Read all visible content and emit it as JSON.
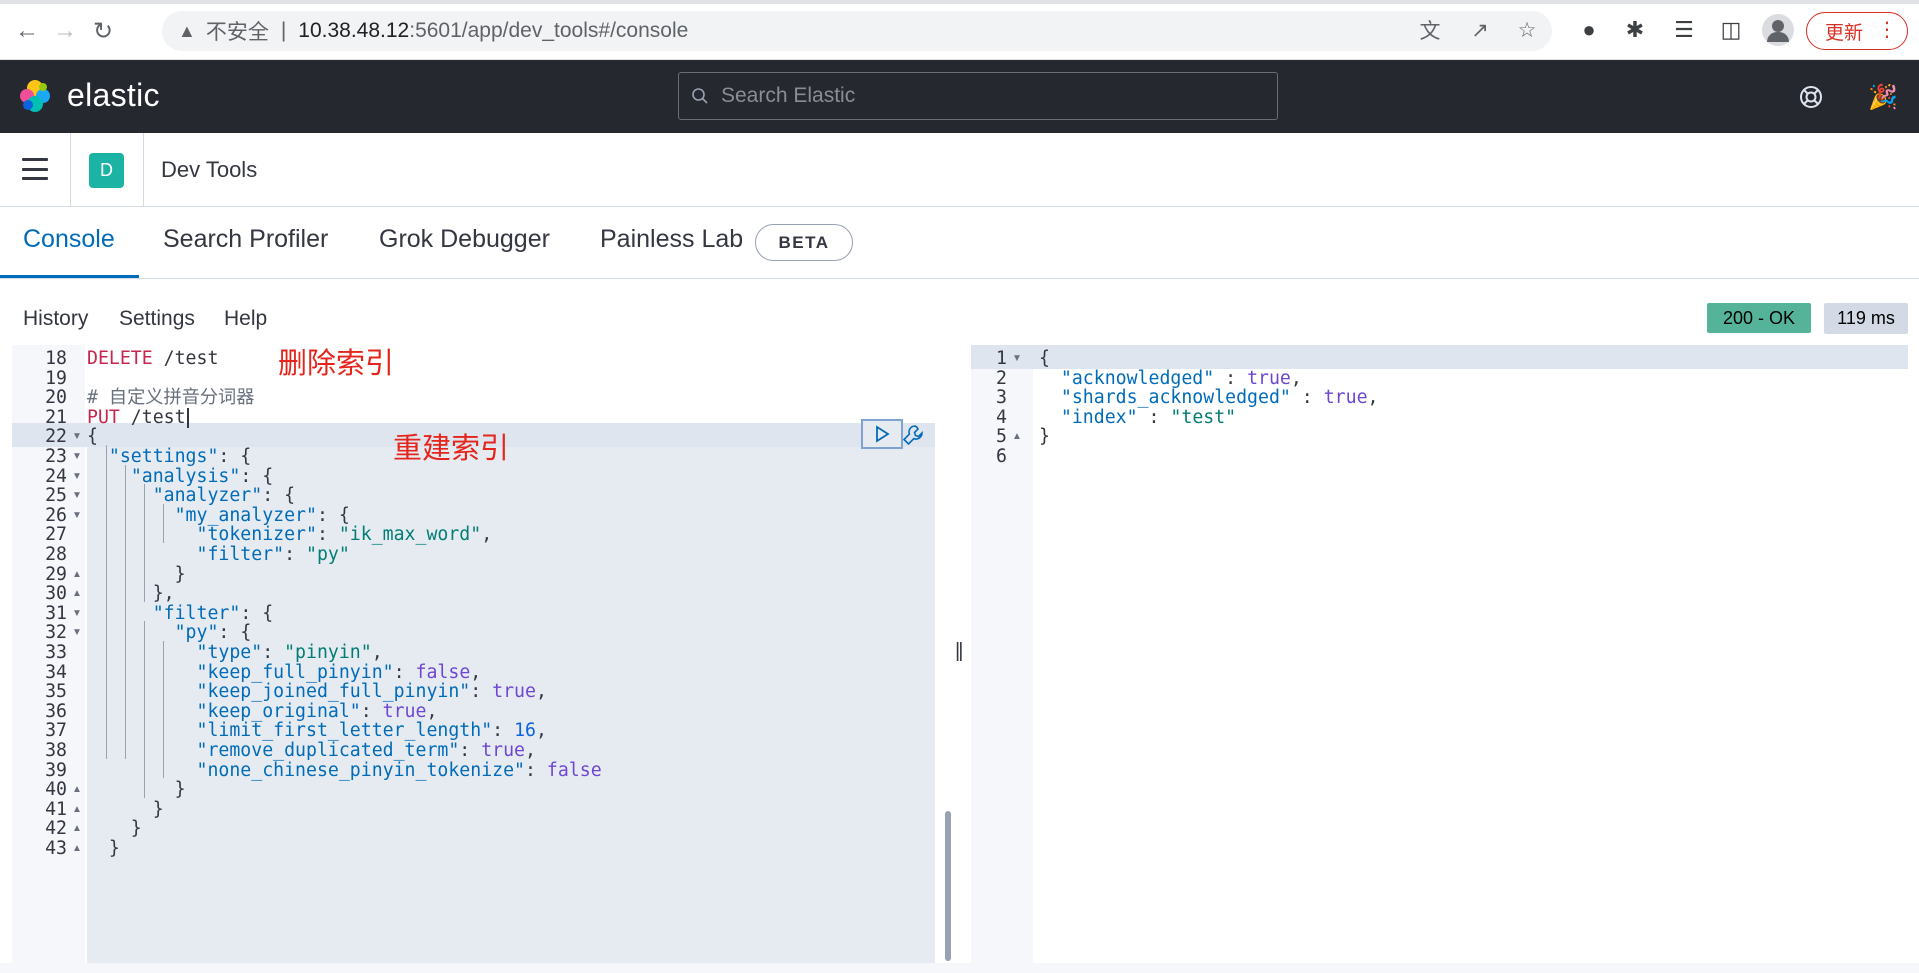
{
  "browser": {
    "security_label": "不安全",
    "url_host": "10.38.48.12",
    "url_path": ":5601/app/dev_tools#/console",
    "update_label": "更新"
  },
  "header": {
    "logo_text": "elastic",
    "search_placeholder": "Search Elastic"
  },
  "breadcrumb": {
    "space_initial": "D",
    "title": "Dev Tools"
  },
  "tabs": [
    {
      "label": "Console",
      "active": true
    },
    {
      "label": "Search Profiler",
      "active": false
    },
    {
      "label": "Grok Debugger",
      "active": false
    },
    {
      "label": "Painless Lab",
      "active": false
    }
  ],
  "beta_badge": "BETA",
  "console_menu": [
    "History",
    "Settings",
    "Help"
  ],
  "status": {
    "code": "200 - OK",
    "time": "119 ms"
  },
  "annotations": {
    "delete_index": "删除索引",
    "rebuild_index": "重建索引"
  },
  "request_lines": [
    {
      "n": "18",
      "text": "DELETE /test"
    },
    {
      "n": "19",
      "text": ""
    },
    {
      "n": "20",
      "text": "# 自定义拼音分词器"
    },
    {
      "n": "21",
      "text": "PUT /test"
    },
    {
      "n": "22",
      "text": "{"
    },
    {
      "n": "23",
      "text": "  \"settings\": {"
    },
    {
      "n": "24",
      "text": "    \"analysis\": {"
    },
    {
      "n": "25",
      "text": "      \"analyzer\": {"
    },
    {
      "n": "26",
      "text": "        \"my_analyzer\": {"
    },
    {
      "n": "27",
      "text": "          \"tokenizer\": \"ik_max_word\","
    },
    {
      "n": "28",
      "text": "          \"filter\": \"py\""
    },
    {
      "n": "29",
      "text": "        }"
    },
    {
      "n": "30",
      "text": "      },"
    },
    {
      "n": "31",
      "text": "      \"filter\": {"
    },
    {
      "n": "32",
      "text": "        \"py\": {"
    },
    {
      "n": "33",
      "text": "          \"type\": \"pinyin\","
    },
    {
      "n": "34",
      "text": "          \"keep_full_pinyin\": false,"
    },
    {
      "n": "35",
      "text": "          \"keep_joined_full_pinyin\": true,"
    },
    {
      "n": "36",
      "text": "          \"keep_original\": true,"
    },
    {
      "n": "37",
      "text": "          \"limit_first_letter_length\": 16,"
    },
    {
      "n": "38",
      "text": "          \"remove_duplicated_term\": true,"
    },
    {
      "n": "39",
      "text": "          \"none_chinese_pinyin_tokenize\": false"
    },
    {
      "n": "40",
      "text": "        }"
    },
    {
      "n": "41",
      "text": "      }"
    },
    {
      "n": "42",
      "text": "    }"
    },
    {
      "n": "43",
      "text": "  }"
    }
  ],
  "response_lines": [
    {
      "n": "1",
      "text": "{"
    },
    {
      "n": "2",
      "text": "  \"acknowledged\" : true,"
    },
    {
      "n": "3",
      "text": "  \"shards_acknowledged\" : true,"
    },
    {
      "n": "4",
      "text": "  \"index\" : \"test\""
    },
    {
      "n": "5",
      "text": "}"
    },
    {
      "n": "6",
      "text": ""
    }
  ],
  "colors": {
    "accent": "#006bb8",
    "header_bg": "#25282f",
    "status_ok": "#54b399",
    "annotation": "#e5241b"
  }
}
